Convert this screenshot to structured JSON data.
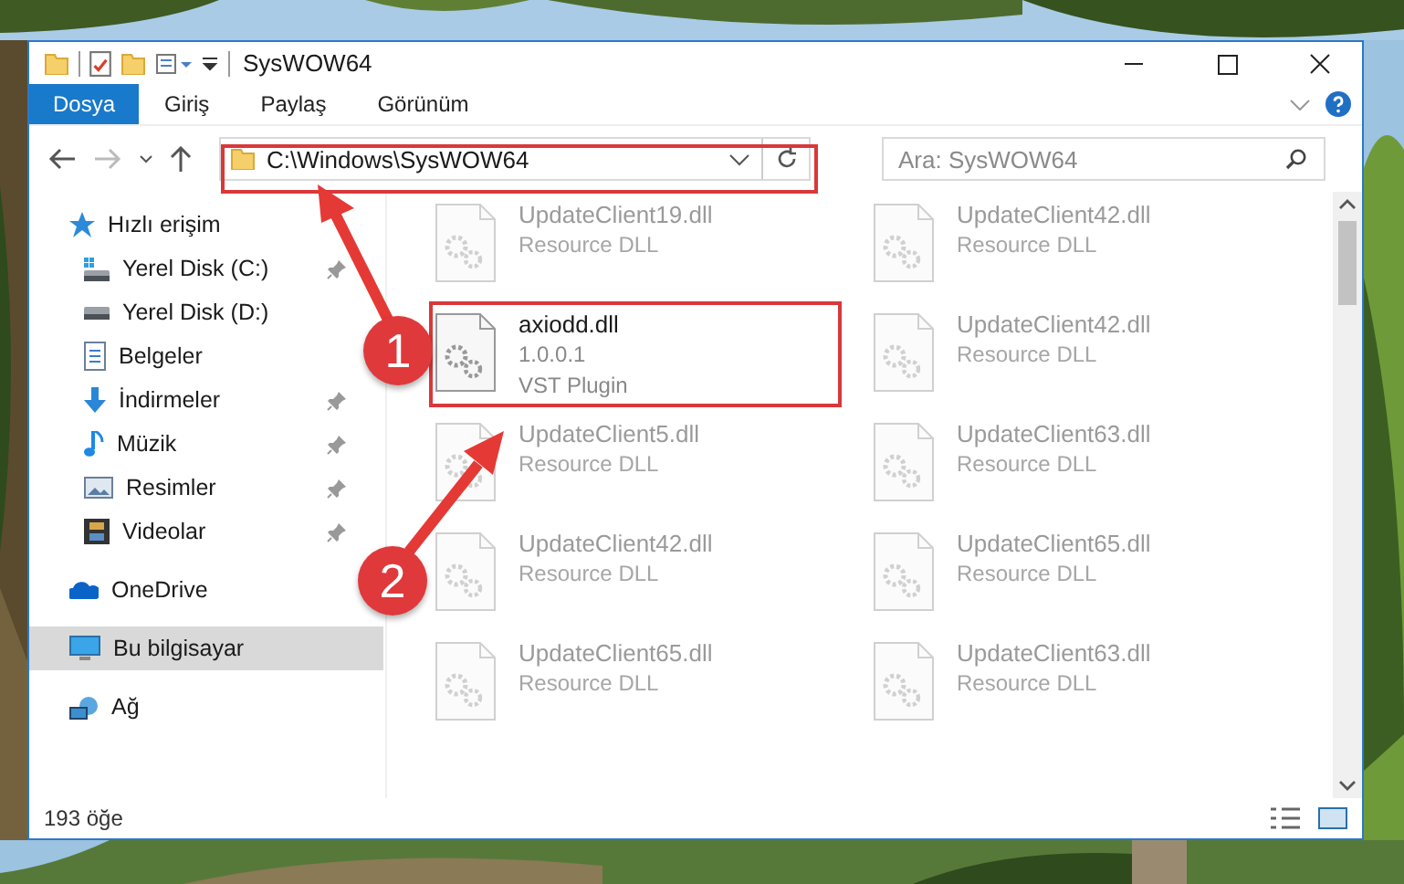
{
  "window": {
    "title": "SysWOW64"
  },
  "ribbon_tabs": [
    {
      "label": "Dosya",
      "selected": true
    },
    {
      "label": "Giriş",
      "selected": false
    },
    {
      "label": "Paylaş",
      "selected": false
    },
    {
      "label": "Görünüm",
      "selected": false
    }
  ],
  "address_bar": {
    "path": "C:\\Windows\\SysWOW64"
  },
  "search": {
    "placeholder": "Ara: SysWOW64"
  },
  "sidebar": {
    "items": [
      {
        "label": "Hızlı erişim",
        "kind": "star",
        "selected": false,
        "children": [
          {
            "label": "Yerel Disk (C:)",
            "kind": "drive-win",
            "pinned": true,
            "selected": false
          },
          {
            "label": "Yerel Disk (D:)",
            "kind": "drive",
            "pinned": false,
            "selected": false
          },
          {
            "label": "Belgeler",
            "kind": "document",
            "pinned": false,
            "selected": false
          },
          {
            "label": "İndirmeler",
            "kind": "download",
            "pinned": true,
            "selected": false
          },
          {
            "label": "Müzik",
            "kind": "music",
            "pinned": true,
            "selected": false
          },
          {
            "label": "Resimler",
            "kind": "pictures",
            "pinned": true,
            "selected": false
          },
          {
            "label": "Videolar",
            "kind": "video",
            "pinned": true,
            "selected": false
          }
        ]
      },
      {
        "label": "OneDrive",
        "kind": "cloud",
        "selected": false
      },
      {
        "label": "Bu bilgisayar",
        "kind": "computer",
        "selected": true
      },
      {
        "label": "Ağ",
        "kind": "network",
        "selected": false
      }
    ]
  },
  "files": [
    {
      "name": "UpdateClient19.dll",
      "lines": [
        "Resource DLL"
      ],
      "blurred": true,
      "highlighted": false
    },
    {
      "name": "UpdateClient42.dll",
      "lines": [
        "Resource DLL"
      ],
      "blurred": true,
      "highlighted": false
    },
    {
      "name": "axiodd.dll",
      "lines": [
        "1.0.0.1",
        "VST Plugin"
      ],
      "blurred": false,
      "highlighted": true
    },
    {
      "name": "UpdateClient42.dll",
      "lines": [
        "Resource DLL"
      ],
      "blurred": true,
      "highlighted": false
    },
    {
      "name": "UpdateClient5.dll",
      "lines": [
        "Resource DLL"
      ],
      "blurred": true,
      "highlighted": false
    },
    {
      "name": "UpdateClient63.dll",
      "lines": [
        "Resource DLL"
      ],
      "blurred": true,
      "highlighted": false
    },
    {
      "name": "UpdateClient42.dll",
      "lines": [
        "Resource DLL"
      ],
      "blurred": true,
      "highlighted": false
    },
    {
      "name": "UpdateClient65.dll",
      "lines": [
        "Resource DLL"
      ],
      "blurred": true,
      "highlighted": false
    },
    {
      "name": "UpdateClient65.dll",
      "lines": [
        "Resource DLL"
      ],
      "blurred": true,
      "highlighted": false
    },
    {
      "name": "UpdateClient63.dll",
      "lines": [
        "Resource DLL"
      ],
      "blurred": true,
      "highlighted": false
    }
  ],
  "status_bar": {
    "count": "193 öğe"
  },
  "annotations": [
    {
      "label": "1"
    },
    {
      "label": "2"
    }
  ]
}
